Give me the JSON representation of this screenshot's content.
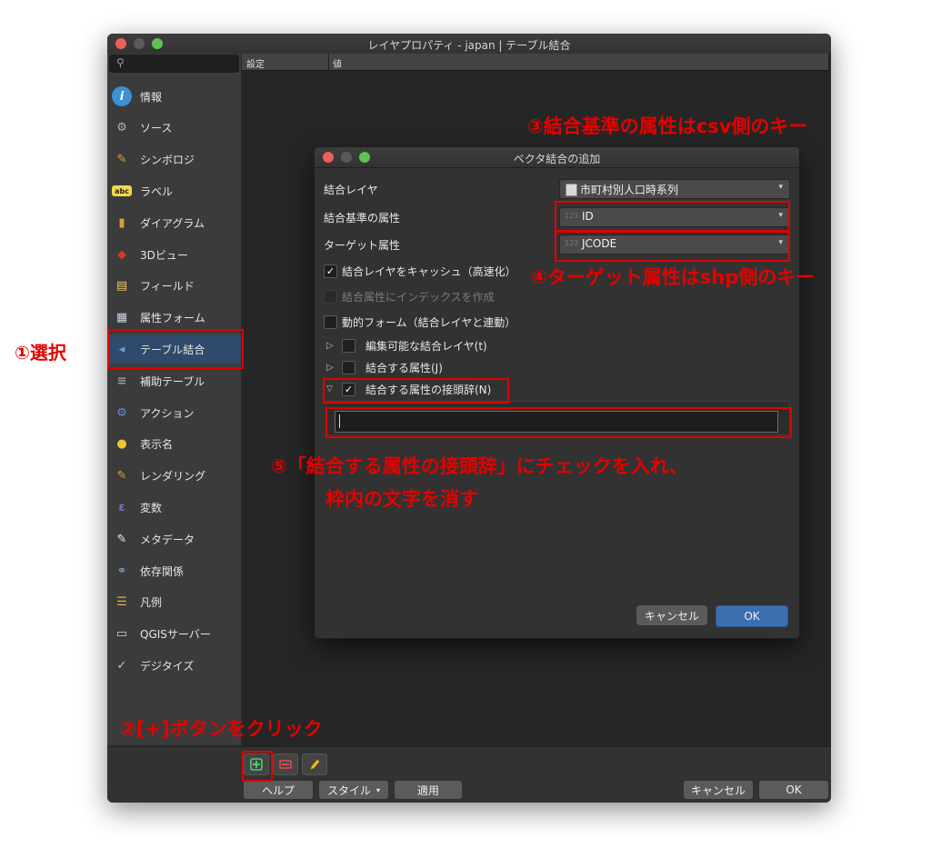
{
  "main_window": {
    "title": "レイヤプロパティ - japan | テーブル結合",
    "search_icon": "search-icon",
    "tree_headers": [
      "設定",
      "値"
    ],
    "sidebar_items": [
      {
        "label": "情報",
        "icon": "info-icon",
        "color": "#3d8fd6"
      },
      {
        "label": "ソース",
        "icon": "source-tools-icon",
        "color": "#b0b0b0"
      },
      {
        "label": "シンボロジ",
        "icon": "symbology-brush-icon",
        "color": "#e0a21e"
      },
      {
        "label": "ラベル",
        "icon": "label-abc-icon",
        "color": "#f3d64a"
      },
      {
        "label": "ダイアグラム",
        "icon": "diagram-icon",
        "color": "#d6a52f"
      },
      {
        "label": "3Dビュー",
        "icon": "3d-cube-icon",
        "color": "#d23a2a"
      },
      {
        "label": "フィールド",
        "icon": "fields-table-icon",
        "color": "#efc75e"
      },
      {
        "label": "属性フォーム",
        "icon": "attribute-form-icon",
        "color": "#c8d4e0"
      },
      {
        "label": "テーブル結合",
        "icon": "join-icon",
        "color": "#6aa0d8"
      },
      {
        "label": "補助テーブル",
        "icon": "auxiliary-storage-icon",
        "color": "#9a9a9a"
      },
      {
        "label": "アクション",
        "icon": "action-gear-icon",
        "color": "#5a8fd0"
      },
      {
        "label": "表示名",
        "icon": "display-speech-icon",
        "color": "#f1c232"
      },
      {
        "label": "レンダリング",
        "icon": "rendering-brush-icon",
        "color": "#d8a040"
      },
      {
        "label": "変数",
        "icon": "variables-icon",
        "color": "#8a6ac0"
      },
      {
        "label": "メタデータ",
        "icon": "metadata-icon",
        "color": "#e8e8e8"
      },
      {
        "label": "依存関係",
        "icon": "dependencies-icon",
        "color": "#6f9fd0"
      },
      {
        "label": "凡例",
        "icon": "legend-icon",
        "color": "#e0b040"
      },
      {
        "label": "QGISサーバー",
        "icon": "qgis-server-icon",
        "color": "#d0d0d0"
      },
      {
        "label": "デジタイズ",
        "icon": "digitizing-icon",
        "color": "#c0d0a0"
      }
    ],
    "selected_item": "テーブル結合",
    "toolbar": {
      "add_icon": "add-join-plus-icon",
      "remove_icon": "remove-join-minus-icon",
      "edit_icon": "edit-join-pencil-icon"
    },
    "buttons": {
      "help": "ヘルプ",
      "style": "スタイル",
      "apply": "適用",
      "cancel": "キャンセル",
      "ok": "OK"
    }
  },
  "join_dialog": {
    "title": "ベクタ結合の追加",
    "join_layer_label": "結合レイヤ",
    "join_layer_value": "市町村別人口時系列",
    "join_field_label": "結合基準の属性",
    "join_field_value": "ID",
    "target_field_label": "ターゲット属性",
    "target_field_value": "JCODE",
    "field_type_badge": "123",
    "cache_label": "結合レイヤをキャッシュ（高速化）",
    "cache_checked": true,
    "index_label": "結合属性にインデックスを作成",
    "index_checked": false,
    "dynamic_form_label": "動的フォーム（結合レイヤと連動）",
    "dynamic_form_checked": false,
    "editable_label": "編集可能な結合レイヤ(t)",
    "subset_label": "結合する属性(J)",
    "prefix_label": "結合する属性の接頭辞(N)",
    "prefix_checked": true,
    "prefix_value": "",
    "check_mark": "✓",
    "cancel_label": "キャンセル",
    "ok_label": "OK"
  },
  "annotations": {
    "step1": "①選択",
    "step2": "②[+]ボタンをクリック",
    "step3": "③結合基準の属性はcsv側のキー",
    "step4": "④ターゲット属性はshp側のキー",
    "step5_line1": "⑤「結合する属性の接頭辞」にチェックを入れ、",
    "step5_line2": "枠内の文字を消す",
    "highlight_color": "#e60000"
  }
}
